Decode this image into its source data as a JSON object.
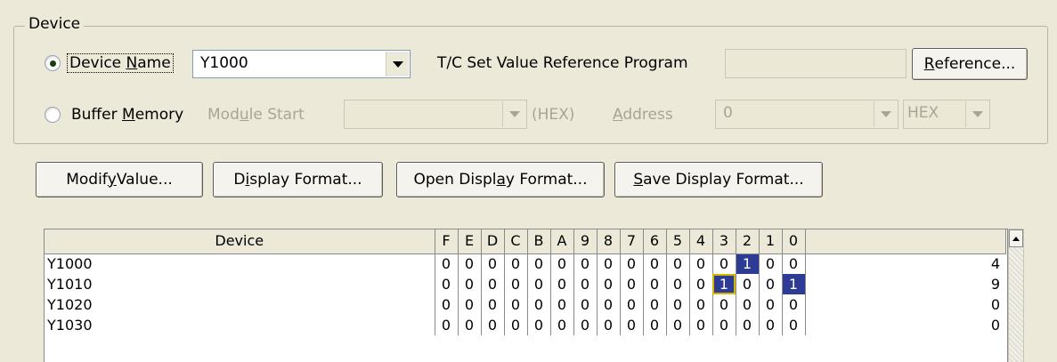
{
  "device_group": {
    "title": "Device",
    "device_name_label_pre": "Device ",
    "device_name_label_u": "N",
    "device_name_label_post": "ame",
    "device_name_value": "Y1000",
    "tc_label": "T/C Set Value Reference Program",
    "tc_value": "",
    "reference_label_u": "R",
    "reference_label_post": "eference...",
    "buffer_label_pre": "Buffer ",
    "buffer_label_u": "M",
    "buffer_label_post": "emory",
    "module_start_pre": "Mod",
    "module_start_u": "u",
    "module_start_post": "le Start",
    "module_start_value": "",
    "hex_suffix": "(HEX)",
    "address_u": "A",
    "address_post": "ddress",
    "address_value": "0",
    "address_format": "HEX"
  },
  "toolbar": {
    "modify_pre": "Modif",
    "modify_u": "y",
    "modify_post": " Value...",
    "display_pre": "D",
    "display_u": "i",
    "display_post": "splay Format...",
    "open_pre": "Open Displ",
    "open_u": "a",
    "open_post": "y Format...",
    "save_u": "S",
    "save_post": "ave Display Format..."
  },
  "table": {
    "header_device": "Device",
    "bit_headers": [
      "F",
      "E",
      "D",
      "C",
      "B",
      "A",
      "9",
      "8",
      "7",
      "6",
      "5",
      "4",
      "3",
      "2",
      "1",
      "0"
    ],
    "header_value": "",
    "rows": [
      {
        "device": "Y1000",
        "bits": [
          "0",
          "0",
          "0",
          "0",
          "0",
          "0",
          "0",
          "0",
          "0",
          "0",
          "0",
          "0",
          "0",
          "1",
          "0",
          "0"
        ],
        "value": "4"
      },
      {
        "device": "Y1010",
        "bits": [
          "0",
          "0",
          "0",
          "0",
          "0",
          "0",
          "0",
          "0",
          "0",
          "0",
          "0",
          "0",
          "1",
          "0",
          "0",
          "1"
        ],
        "value": "9"
      },
      {
        "device": "Y1020",
        "bits": [
          "0",
          "0",
          "0",
          "0",
          "0",
          "0",
          "0",
          "0",
          "0",
          "0",
          "0",
          "0",
          "0",
          "0",
          "0",
          "0"
        ],
        "value": "0"
      },
      {
        "device": "Y1030",
        "bits": [
          "0",
          "0",
          "0",
          "0",
          "0",
          "0",
          "0",
          "0",
          "0",
          "0",
          "0",
          "0",
          "0",
          "0",
          "0",
          "0"
        ],
        "value": "0"
      }
    ],
    "highlight_color": "#2e3b94",
    "cursor_color": "#d4b800"
  }
}
